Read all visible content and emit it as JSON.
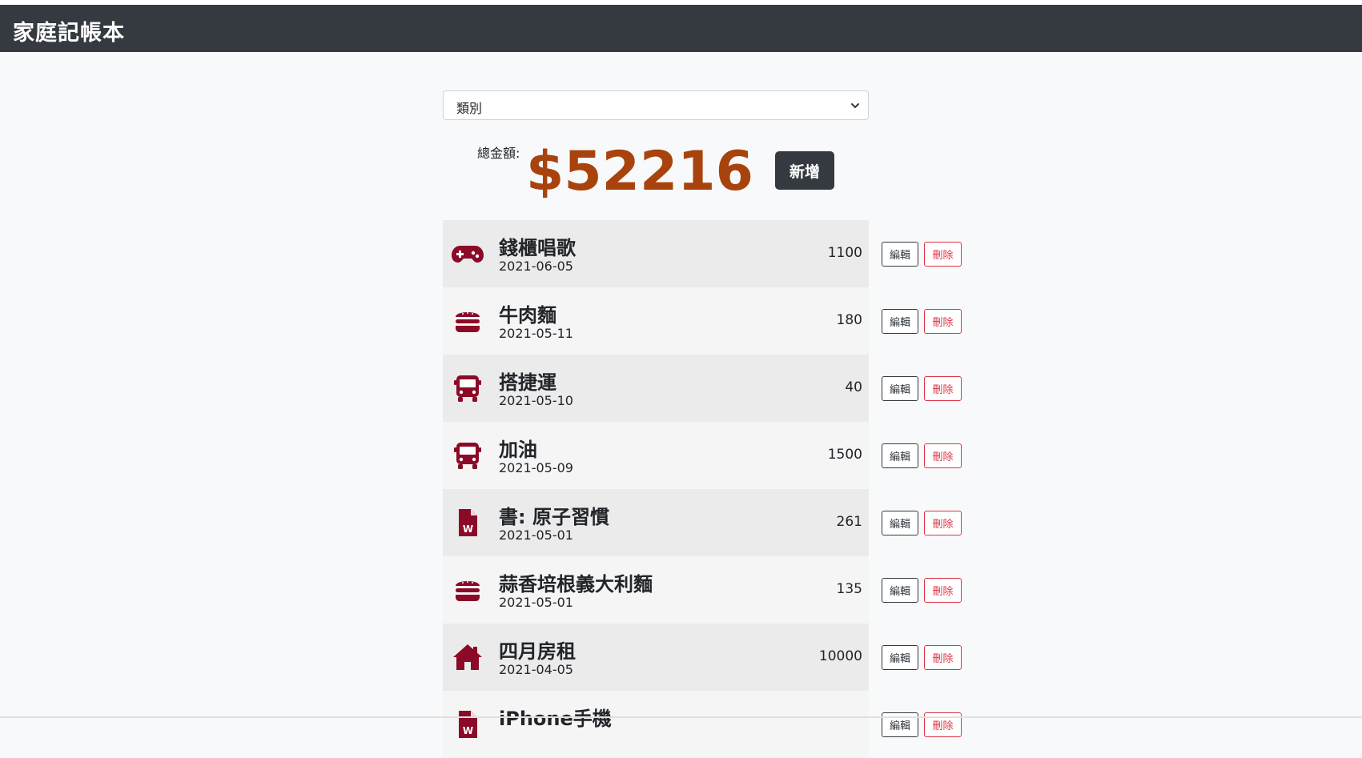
{
  "app": {
    "title": "家庭記帳本"
  },
  "filter": {
    "selected": "類別"
  },
  "summary": {
    "label": "總金額:",
    "amount": "$52216",
    "add_label": "新增"
  },
  "colors": {
    "icon": "#8b0a27",
    "amount": "#a8430d",
    "navbar": "#343a40",
    "delete": "#dc3545"
  },
  "actions": {
    "edit_label": "編輯",
    "delete_label": "刪除"
  },
  "records": [
    {
      "icon": "gamepad-icon",
      "title": "錢櫃唱歌",
      "date": "2021-06-05",
      "amount": "1100"
    },
    {
      "icon": "hamburger-icon",
      "title": "牛肉麵",
      "date": "2021-05-11",
      "amount": "180"
    },
    {
      "icon": "bus-icon",
      "title": "搭捷運",
      "date": "2021-05-10",
      "amount": "40"
    },
    {
      "icon": "bus-icon",
      "title": "加油",
      "date": "2021-05-09",
      "amount": "1500"
    },
    {
      "icon": "word-file-icon",
      "title": "書: 原子習慣",
      "date": "2021-05-01",
      "amount": "261"
    },
    {
      "icon": "hamburger-icon",
      "title": "蒜香培根義大利麵",
      "date": "2021-05-01",
      "amount": "135"
    },
    {
      "icon": "home-icon",
      "title": "四月房租",
      "date": "2021-04-05",
      "amount": "10000"
    },
    {
      "icon": "word-file-icon",
      "title": "iPhone手機",
      "date": "",
      "amount": ""
    }
  ]
}
